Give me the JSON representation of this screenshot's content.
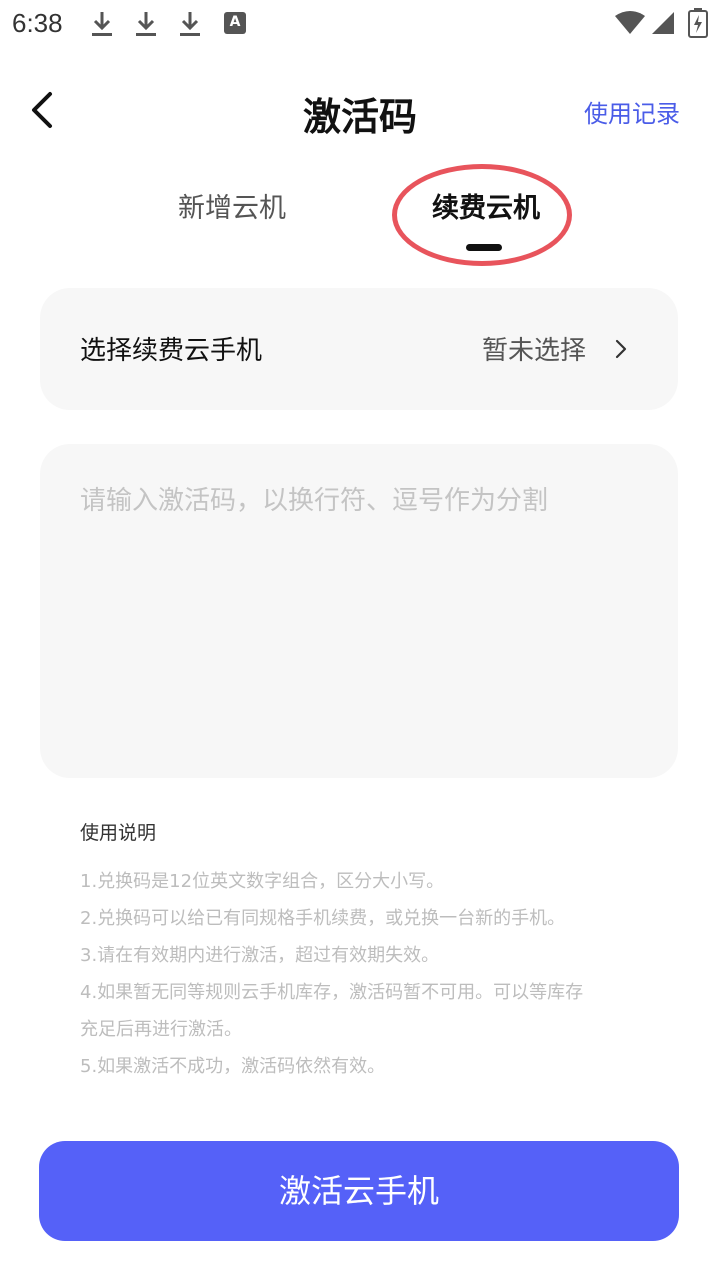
{
  "status_bar": {
    "time": "6:38",
    "icons": [
      "download-icon",
      "download-icon",
      "download-icon",
      "a-notification-icon",
      "wifi-icon",
      "signal-icon",
      "battery-charging-icon"
    ],
    "a_icon_label": "A"
  },
  "header": {
    "title": "激活码",
    "history_link": "使用记录"
  },
  "tabs": [
    {
      "label": "新增云机",
      "active": false
    },
    {
      "label": "续费云机",
      "active": true
    }
  ],
  "select_card": {
    "label": "选择续费云手机",
    "value": "暂未选择"
  },
  "code_input": {
    "value": "",
    "placeholder": "请输入激活码，以换行符、逗号作为分割"
  },
  "usage": {
    "title": "使用说明",
    "lines": [
      "1.兑换码是12位英文数字组合，区分大小写。",
      "2.兑换码可以给已有同规格手机续费，或兑换一台新的手机。",
      "3.请在有效期内进行激活，超过有效期失效。",
      "4.如果暂无同等规则云手机库存，激活码暂不可用。可以等库存",
      "充足后再进行激活。",
      "5.如果激活不成功，激活码依然有效。"
    ]
  },
  "activate_button": "激活云手机",
  "colors": {
    "accent": "#5561f8",
    "link": "#4a5ce8",
    "annotation": "#e8545c",
    "card_bg": "#f7f7f7"
  }
}
